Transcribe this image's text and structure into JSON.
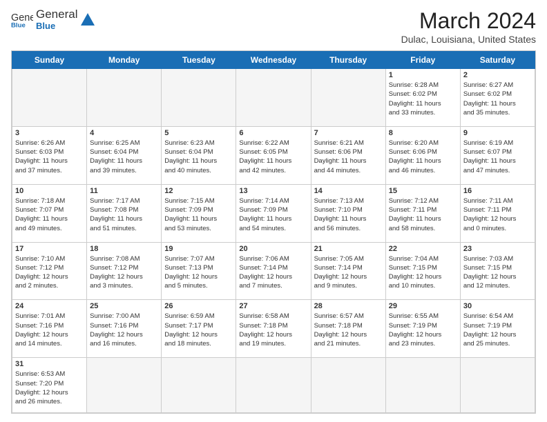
{
  "header": {
    "logo_general": "General",
    "logo_blue": "Blue",
    "month_title": "March 2024",
    "location": "Dulac, Louisiana, United States"
  },
  "weekdays": [
    "Sunday",
    "Monday",
    "Tuesday",
    "Wednesday",
    "Thursday",
    "Friday",
    "Saturday"
  ],
  "weeks": [
    [
      {
        "day": "",
        "info": ""
      },
      {
        "day": "",
        "info": ""
      },
      {
        "day": "",
        "info": ""
      },
      {
        "day": "",
        "info": ""
      },
      {
        "day": "",
        "info": ""
      },
      {
        "day": "1",
        "info": "Sunrise: 6:28 AM\nSunset: 6:02 PM\nDaylight: 11 hours\nand 33 minutes."
      },
      {
        "day": "2",
        "info": "Sunrise: 6:27 AM\nSunset: 6:02 PM\nDaylight: 11 hours\nand 35 minutes."
      }
    ],
    [
      {
        "day": "3",
        "info": "Sunrise: 6:26 AM\nSunset: 6:03 PM\nDaylight: 11 hours\nand 37 minutes."
      },
      {
        "day": "4",
        "info": "Sunrise: 6:25 AM\nSunset: 6:04 PM\nDaylight: 11 hours\nand 39 minutes."
      },
      {
        "day": "5",
        "info": "Sunrise: 6:23 AM\nSunset: 6:04 PM\nDaylight: 11 hours\nand 40 minutes."
      },
      {
        "day": "6",
        "info": "Sunrise: 6:22 AM\nSunset: 6:05 PM\nDaylight: 11 hours\nand 42 minutes."
      },
      {
        "day": "7",
        "info": "Sunrise: 6:21 AM\nSunset: 6:06 PM\nDaylight: 11 hours\nand 44 minutes."
      },
      {
        "day": "8",
        "info": "Sunrise: 6:20 AM\nSunset: 6:06 PM\nDaylight: 11 hours\nand 46 minutes."
      },
      {
        "day": "9",
        "info": "Sunrise: 6:19 AM\nSunset: 6:07 PM\nDaylight: 11 hours\nand 47 minutes."
      }
    ],
    [
      {
        "day": "10",
        "info": "Sunrise: 7:18 AM\nSunset: 7:07 PM\nDaylight: 11 hours\nand 49 minutes."
      },
      {
        "day": "11",
        "info": "Sunrise: 7:17 AM\nSunset: 7:08 PM\nDaylight: 11 hours\nand 51 minutes."
      },
      {
        "day": "12",
        "info": "Sunrise: 7:15 AM\nSunset: 7:09 PM\nDaylight: 11 hours\nand 53 minutes."
      },
      {
        "day": "13",
        "info": "Sunrise: 7:14 AM\nSunset: 7:09 PM\nDaylight: 11 hours\nand 54 minutes."
      },
      {
        "day": "14",
        "info": "Sunrise: 7:13 AM\nSunset: 7:10 PM\nDaylight: 11 hours\nand 56 minutes."
      },
      {
        "day": "15",
        "info": "Sunrise: 7:12 AM\nSunset: 7:11 PM\nDaylight: 11 hours\nand 58 minutes."
      },
      {
        "day": "16",
        "info": "Sunrise: 7:11 AM\nSunset: 7:11 PM\nDaylight: 12 hours\nand 0 minutes."
      }
    ],
    [
      {
        "day": "17",
        "info": "Sunrise: 7:10 AM\nSunset: 7:12 PM\nDaylight: 12 hours\nand 2 minutes."
      },
      {
        "day": "18",
        "info": "Sunrise: 7:08 AM\nSunset: 7:12 PM\nDaylight: 12 hours\nand 3 minutes."
      },
      {
        "day": "19",
        "info": "Sunrise: 7:07 AM\nSunset: 7:13 PM\nDaylight: 12 hours\nand 5 minutes."
      },
      {
        "day": "20",
        "info": "Sunrise: 7:06 AM\nSunset: 7:14 PM\nDaylight: 12 hours\nand 7 minutes."
      },
      {
        "day": "21",
        "info": "Sunrise: 7:05 AM\nSunset: 7:14 PM\nDaylight: 12 hours\nand 9 minutes."
      },
      {
        "day": "22",
        "info": "Sunrise: 7:04 AM\nSunset: 7:15 PM\nDaylight: 12 hours\nand 10 minutes."
      },
      {
        "day": "23",
        "info": "Sunrise: 7:03 AM\nSunset: 7:15 PM\nDaylight: 12 hours\nand 12 minutes."
      }
    ],
    [
      {
        "day": "24",
        "info": "Sunrise: 7:01 AM\nSunset: 7:16 PM\nDaylight: 12 hours\nand 14 minutes."
      },
      {
        "day": "25",
        "info": "Sunrise: 7:00 AM\nSunset: 7:16 PM\nDaylight: 12 hours\nand 16 minutes."
      },
      {
        "day": "26",
        "info": "Sunrise: 6:59 AM\nSunset: 7:17 PM\nDaylight: 12 hours\nand 18 minutes."
      },
      {
        "day": "27",
        "info": "Sunrise: 6:58 AM\nSunset: 7:18 PM\nDaylight: 12 hours\nand 19 minutes."
      },
      {
        "day": "28",
        "info": "Sunrise: 6:57 AM\nSunset: 7:18 PM\nDaylight: 12 hours\nand 21 minutes."
      },
      {
        "day": "29",
        "info": "Sunrise: 6:55 AM\nSunset: 7:19 PM\nDaylight: 12 hours\nand 23 minutes."
      },
      {
        "day": "30",
        "info": "Sunrise: 6:54 AM\nSunset: 7:19 PM\nDaylight: 12 hours\nand 25 minutes."
      }
    ],
    [
      {
        "day": "31",
        "info": "Sunrise: 6:53 AM\nSunset: 7:20 PM\nDaylight: 12 hours\nand 26 minutes."
      },
      {
        "day": "",
        "info": ""
      },
      {
        "day": "",
        "info": ""
      },
      {
        "day": "",
        "info": ""
      },
      {
        "day": "",
        "info": ""
      },
      {
        "day": "",
        "info": ""
      },
      {
        "day": "",
        "info": ""
      }
    ]
  ]
}
